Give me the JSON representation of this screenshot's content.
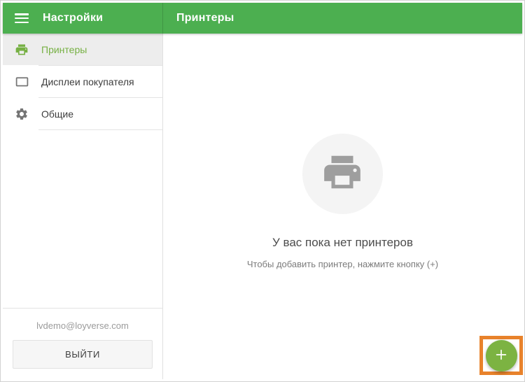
{
  "header": {
    "left_title": "Настройки",
    "right_title": "Принтеры"
  },
  "sidebar": {
    "items": [
      {
        "label": "Принтеры",
        "icon": "printer-icon",
        "selected": true
      },
      {
        "label": "Дисплеи покупателя",
        "icon": "customer-display-icon",
        "selected": false
      },
      {
        "label": "Общие",
        "icon": "gear-icon",
        "selected": false
      }
    ],
    "account_email": "lvdemo@loyverse.com",
    "logout_label": "ВЫЙТИ"
  },
  "main": {
    "empty_title": "У вас пока нет принтеров",
    "empty_hint": "Чтобы добавить принтер, нажмите кнопку (+)",
    "empty_icon": "printer-icon",
    "fab_icon": "plus-icon"
  },
  "colors": {
    "header_green": "#4caf50",
    "accent_green": "#76b043",
    "fab_green": "#7cb342",
    "highlight_orange": "#e8822b",
    "selected_row_bg": "#ededed",
    "empty_circle_bg": "#f4f4f4",
    "icon_gray": "#9e9e9e"
  }
}
